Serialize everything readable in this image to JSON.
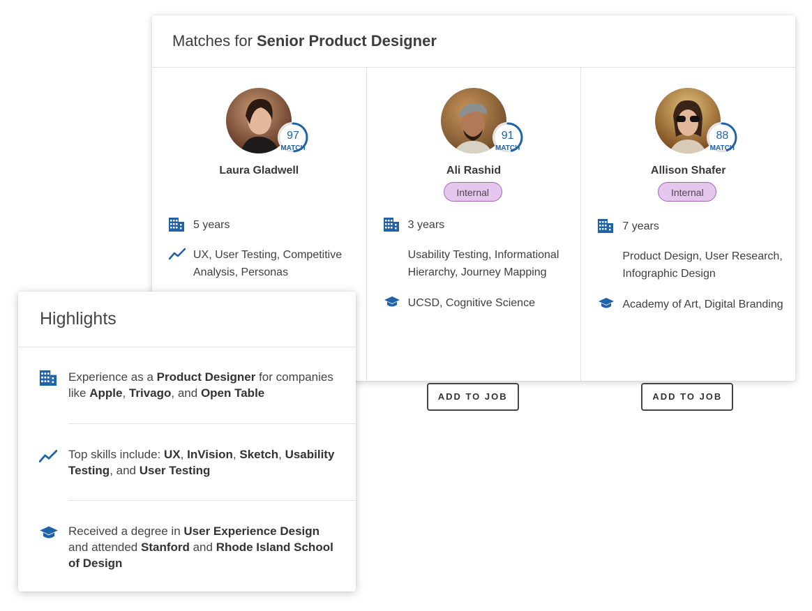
{
  "matches": {
    "title_prefix": "Matches for",
    "title_role": "Senior Product Designer",
    "add_label": "ADD TO JOB",
    "candidates": [
      {
        "name": "Laura Gladwell",
        "score": "97",
        "score_fraction": 0.97,
        "match_label": "MATCH",
        "badge": "",
        "experience": "5 years",
        "skills": "UX, User Testing, Competitive Analysis, Personas",
        "education": ""
      },
      {
        "name": "Ali Rashid",
        "score": "91",
        "score_fraction": 0.91,
        "match_label": "MATCH",
        "badge": "Internal",
        "experience": "3 years",
        "skills": "Usability Testing, Informational Hierarchy, Journey Mapping",
        "education": "UCSD, Cognitive Science"
      },
      {
        "name": "Allison Shafer",
        "score": "88",
        "score_fraction": 0.88,
        "match_label": "MATCH",
        "badge": "Internal",
        "experience": "7 years",
        "skills": "Product Design, User Research, Infographic Design",
        "education": "Academy of Art, Digital Branding"
      }
    ]
  },
  "highlights": {
    "title": "Highlights",
    "items": [
      {
        "icon": "building-icon",
        "parts": [
          {
            "t": "Experience as a ",
            "b": false
          },
          {
            "t": "Product Designer",
            "b": true
          },
          {
            "t": " for companies like ",
            "b": false
          },
          {
            "t": "Apple",
            "b": true
          },
          {
            "t": ", ",
            "b": false
          },
          {
            "t": "Trivago",
            "b": true
          },
          {
            "t": ", and ",
            "b": false
          },
          {
            "t": "Open Table",
            "b": true
          }
        ]
      },
      {
        "icon": "trend-chart-icon",
        "parts": [
          {
            "t": "Top skills include: ",
            "b": false
          },
          {
            "t": "UX",
            "b": true
          },
          {
            "t": ", ",
            "b": false
          },
          {
            "t": "InVision",
            "b": true
          },
          {
            "t": ", ",
            "b": false
          },
          {
            "t": "Sketch",
            "b": true
          },
          {
            "t": ", ",
            "b": false
          },
          {
            "t": "Usability Testing",
            "b": true
          },
          {
            "t": ", and ",
            "b": false
          },
          {
            "t": "User Testing",
            "b": true
          }
        ]
      },
      {
        "icon": "graduation-cap-icon",
        "parts": [
          {
            "t": "Received a degree in ",
            "b": false
          },
          {
            "t": "User Experience Design",
            "b": true
          },
          {
            "t": " and attended ",
            "b": false
          },
          {
            "t": "Stanford",
            "b": true
          },
          {
            "t": " and ",
            "b": false
          },
          {
            "t": "Rhode Island School of Design",
            "b": true
          }
        ]
      }
    ]
  },
  "colors": {
    "accent_blue": "#1f62a8",
    "badge_fill": "#e4c6ee",
    "badge_border": "#a266b8"
  }
}
